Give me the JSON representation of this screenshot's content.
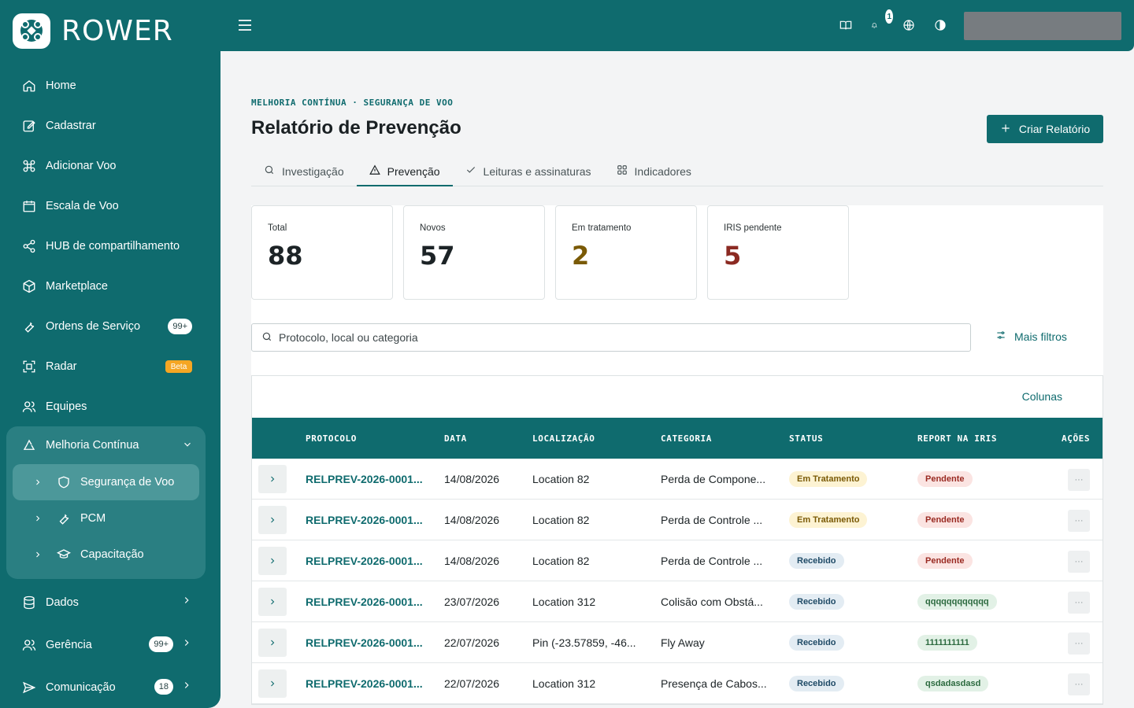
{
  "brand": {
    "name": "ROWER"
  },
  "sidebar": {
    "items": [
      {
        "label": "Home",
        "icon": "home-icon"
      },
      {
        "label": "Cadastrar",
        "icon": "edit-icon"
      },
      {
        "label": "Adicionar Voo",
        "icon": "drone-icon"
      },
      {
        "label": "Escala de Voo",
        "icon": "calendar-icon"
      },
      {
        "label": "HUB de compartilhamento",
        "icon": "share-icon"
      },
      {
        "label": "Marketplace",
        "icon": "box-icon"
      },
      {
        "label": "Ordens de Serviço",
        "icon": "wrench-icon",
        "badge": "99+"
      },
      {
        "label": "Radar",
        "icon": "radar-icon",
        "badge": "Beta"
      },
      {
        "label": "Equipes",
        "icon": "users-icon"
      }
    ],
    "group": {
      "label": "Melhoria Contínua",
      "icon": "recycle-icon",
      "children": [
        {
          "label": "Segurança de Voo",
          "icon": "shield-icon",
          "active": true
        },
        {
          "label": "PCM",
          "icon": "tool-icon"
        },
        {
          "label": "Capacitação",
          "icon": "graduation-cap-icon"
        }
      ]
    },
    "bottom": [
      {
        "label": "Dados",
        "icon": "database-icon"
      },
      {
        "label": "Gerência",
        "icon": "users-icon",
        "badge": "99+"
      },
      {
        "label": "Comunicação",
        "icon": "send-icon",
        "badge": "18"
      }
    ]
  },
  "topbar": {
    "notification_count": "1"
  },
  "page": {
    "breadcrumb": "MELHORIA CONTÍNUA · SEGURANÇA DE VOO",
    "title": "Relatório de Prevenção",
    "create_button": "Criar Relatório"
  },
  "tabs": [
    {
      "label": "Investigação",
      "icon": "search-icon"
    },
    {
      "label": "Prevenção",
      "icon": "warning-icon",
      "active": true
    },
    {
      "label": "Leituras e assinaturas",
      "icon": "check-icon"
    },
    {
      "label": "Indicadores",
      "icon": "grid-icon"
    }
  ],
  "stats": [
    {
      "label": "Total",
      "value": "88",
      "color": "#1a2023"
    },
    {
      "label": "Novos",
      "value": "57",
      "color": "#1a2023"
    },
    {
      "label": "Em tratamento",
      "value": "2",
      "color": "#7a5a06"
    },
    {
      "label": "IRIS pendente",
      "value": "5",
      "color": "#8b2a22"
    }
  ],
  "search": {
    "placeholder": "Protocolo, local ou categoria"
  },
  "filters": {
    "more_label": "Mais filtros"
  },
  "table": {
    "columns_link": "Colunas",
    "headers": [
      "PROTOCOLO",
      "DATA",
      "LOCALIZAÇÃO",
      "CATEGORIA",
      "STATUS",
      "REPORT NA IRIS",
      "AÇÕES"
    ],
    "rows": [
      {
        "protocol": "RELPREV-2026-0001...",
        "date": "14/08/2026",
        "location": "Location 82",
        "category": "Perda de Compone...",
        "status": "Em Tratamento",
        "iris": "Pendente"
      },
      {
        "protocol": "RELPREV-2026-0001...",
        "date": "14/08/2026",
        "location": "Location 82",
        "category": "Perda de Controle ...",
        "status": "Em Tratamento",
        "iris": "Pendente"
      },
      {
        "protocol": "RELPREV-2026-0001...",
        "date": "14/08/2026",
        "location": "Location 82",
        "category": "Perda de Controle ...",
        "status": "Recebido",
        "iris": "Pendente"
      },
      {
        "protocol": "RELPREV-2026-0001...",
        "date": "23/07/2026",
        "location": "Location 312",
        "category": "Colisão com Obstá...",
        "status": "Recebido",
        "iris": "qqqqqqqqqqqq"
      },
      {
        "protocol": "RELPREV-2026-0001...",
        "date": "22/07/2026",
        "location": "Pin (-23.57859, -46...",
        "category": "Fly Away",
        "status": "Recebido",
        "iris": "1111111111"
      },
      {
        "protocol": "RELPREV-2026-0001...",
        "date": "22/07/2026",
        "location": "Location 312",
        "category": "Presença de Cabos...",
        "status": "Recebido",
        "iris": "qsdadasdasd"
      }
    ]
  },
  "colors": {
    "primary": "#0f6b6e",
    "status_em_tratamento_bg": "#fdf3d3",
    "status_em_tratamento_fg": "#7a5a06",
    "status_recebido_bg": "#e3ecf3",
    "status_recebido_fg": "#1f4a66",
    "iris_pendente_bg": "#fbe4e2",
    "iris_pendente_fg": "#9a2a22",
    "iris_ok_bg": "#e2f1e6",
    "iris_ok_fg": "#2c6a3f"
  }
}
